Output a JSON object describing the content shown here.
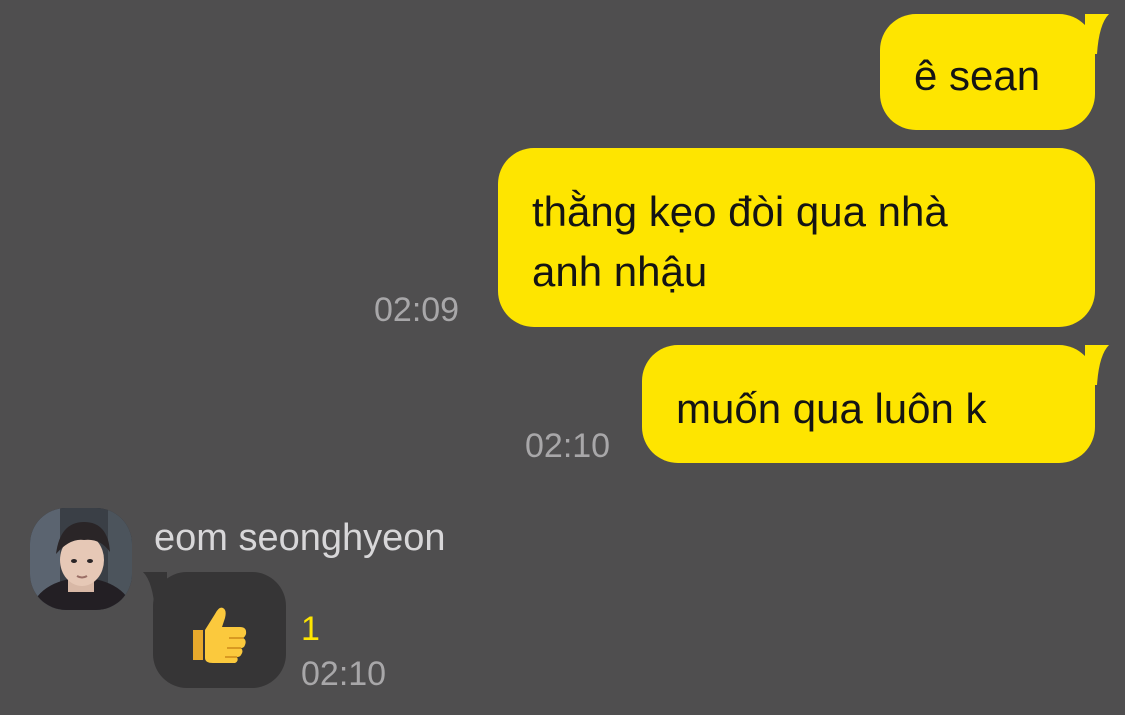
{
  "messages_out": [
    {
      "text": "ê sean",
      "time": ""
    },
    {
      "text_line1": "thằng kẹo đòi qua nhà",
      "text_line2": "anh nhậu",
      "time": "02:09"
    },
    {
      "text": "muốn qua luôn k",
      "time": "02:10"
    }
  ],
  "message_in": {
    "sender": "eom seonghyeon",
    "content_icon": "thumbs-up-emoji",
    "unread_count": "1",
    "time": "02:10"
  },
  "colors": {
    "background": "#4f4e4f",
    "outgoing_bubble": "#fee500",
    "incoming_bubble": "#363536",
    "unread_count": "#fee500"
  }
}
